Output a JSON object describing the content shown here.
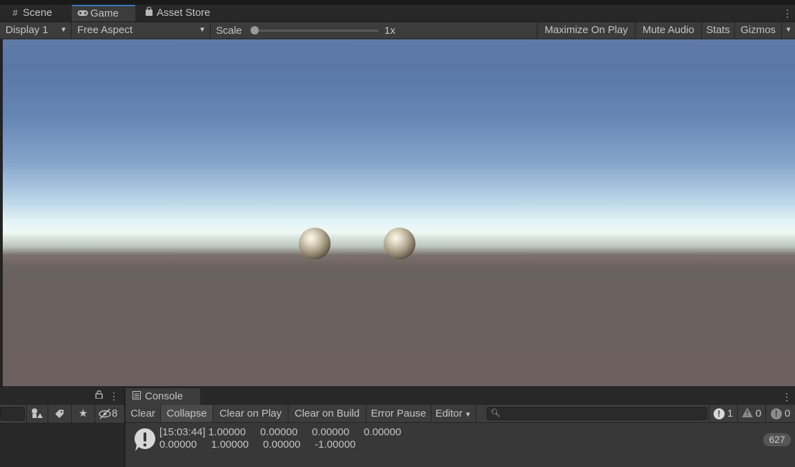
{
  "tabs": [
    {
      "label": "Scene",
      "icon": "grid-icon"
    },
    {
      "label": "Game",
      "icon": "gamepad-icon"
    },
    {
      "label": "Asset Store",
      "icon": "store-bag-icon"
    }
  ],
  "game_toolbar": {
    "display": "Display 1",
    "aspect": "Free Aspect",
    "scale_label": "Scale",
    "scale_value": "1x",
    "maximize": "Maximize On Play",
    "mute": "Mute Audio",
    "stats": "Stats",
    "gizmos": "Gizmos"
  },
  "hierarchy": {
    "hidden_count": "8"
  },
  "console": {
    "tab_label": "Console",
    "buttons": {
      "clear": "Clear",
      "collapse": "Collapse",
      "clear_on_play": "Clear on Play",
      "clear_on_build": "Clear on Build",
      "error_pause": "Error Pause",
      "editor": "Editor"
    },
    "search_placeholder": "",
    "counts": {
      "info": "1",
      "warnings": "0",
      "errors": "0"
    },
    "entries": [
      {
        "line1": "[15:03:44] 1.00000     0.00000     0.00000     0.00000",
        "line2": "0.00000     1.00000     0.00000     -1.00000",
        "count": "627"
      }
    ]
  },
  "colors": {
    "accent": "#3a79bb",
    "panel": "#3c3c3c",
    "dark": "#282828"
  }
}
